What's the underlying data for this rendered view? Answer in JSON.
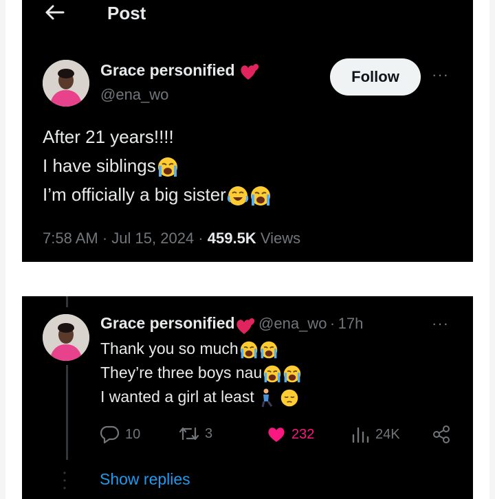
{
  "header": {
    "title": "Post"
  },
  "main_post": {
    "author_name": "Grace personified",
    "handle": "@ena_wo",
    "follow_label": "Follow",
    "more_label": "···",
    "lines": [
      "After 21 years!!!!",
      "I have siblings",
      "I’m officially a big sister"
    ],
    "time": "7:58 AM",
    "date": "Jul 15, 2024",
    "views_count": "459.5K",
    "views_label": "Views",
    "separator": "·"
  },
  "reply": {
    "author_name": "Grace personified",
    "handle": "@ena_wo",
    "separator": "·",
    "age": "17h",
    "more_label": "···",
    "lines": [
      "Thank you so much",
      "They’re three boys nau",
      "I wanted a girl at least"
    ],
    "actions": {
      "replies": "10",
      "reposts": "3",
      "likes": "232",
      "views": "24K"
    },
    "show_replies_label": "Show replies"
  },
  "colors": {
    "background": "#000000",
    "primary_text": "#e7e9ea",
    "secondary_text": "#71767b",
    "link": "#1d9bf0",
    "like": "#f91880"
  },
  "icons": [
    "back-arrow-icon",
    "heart-emoji-icon",
    "loudly-crying-emoji",
    "tears-of-joy-emoji",
    "kneeling-person-emoji",
    "pensive-emoji",
    "reply-icon",
    "repost-icon",
    "like-icon",
    "analytics-icon",
    "share-icon"
  ]
}
